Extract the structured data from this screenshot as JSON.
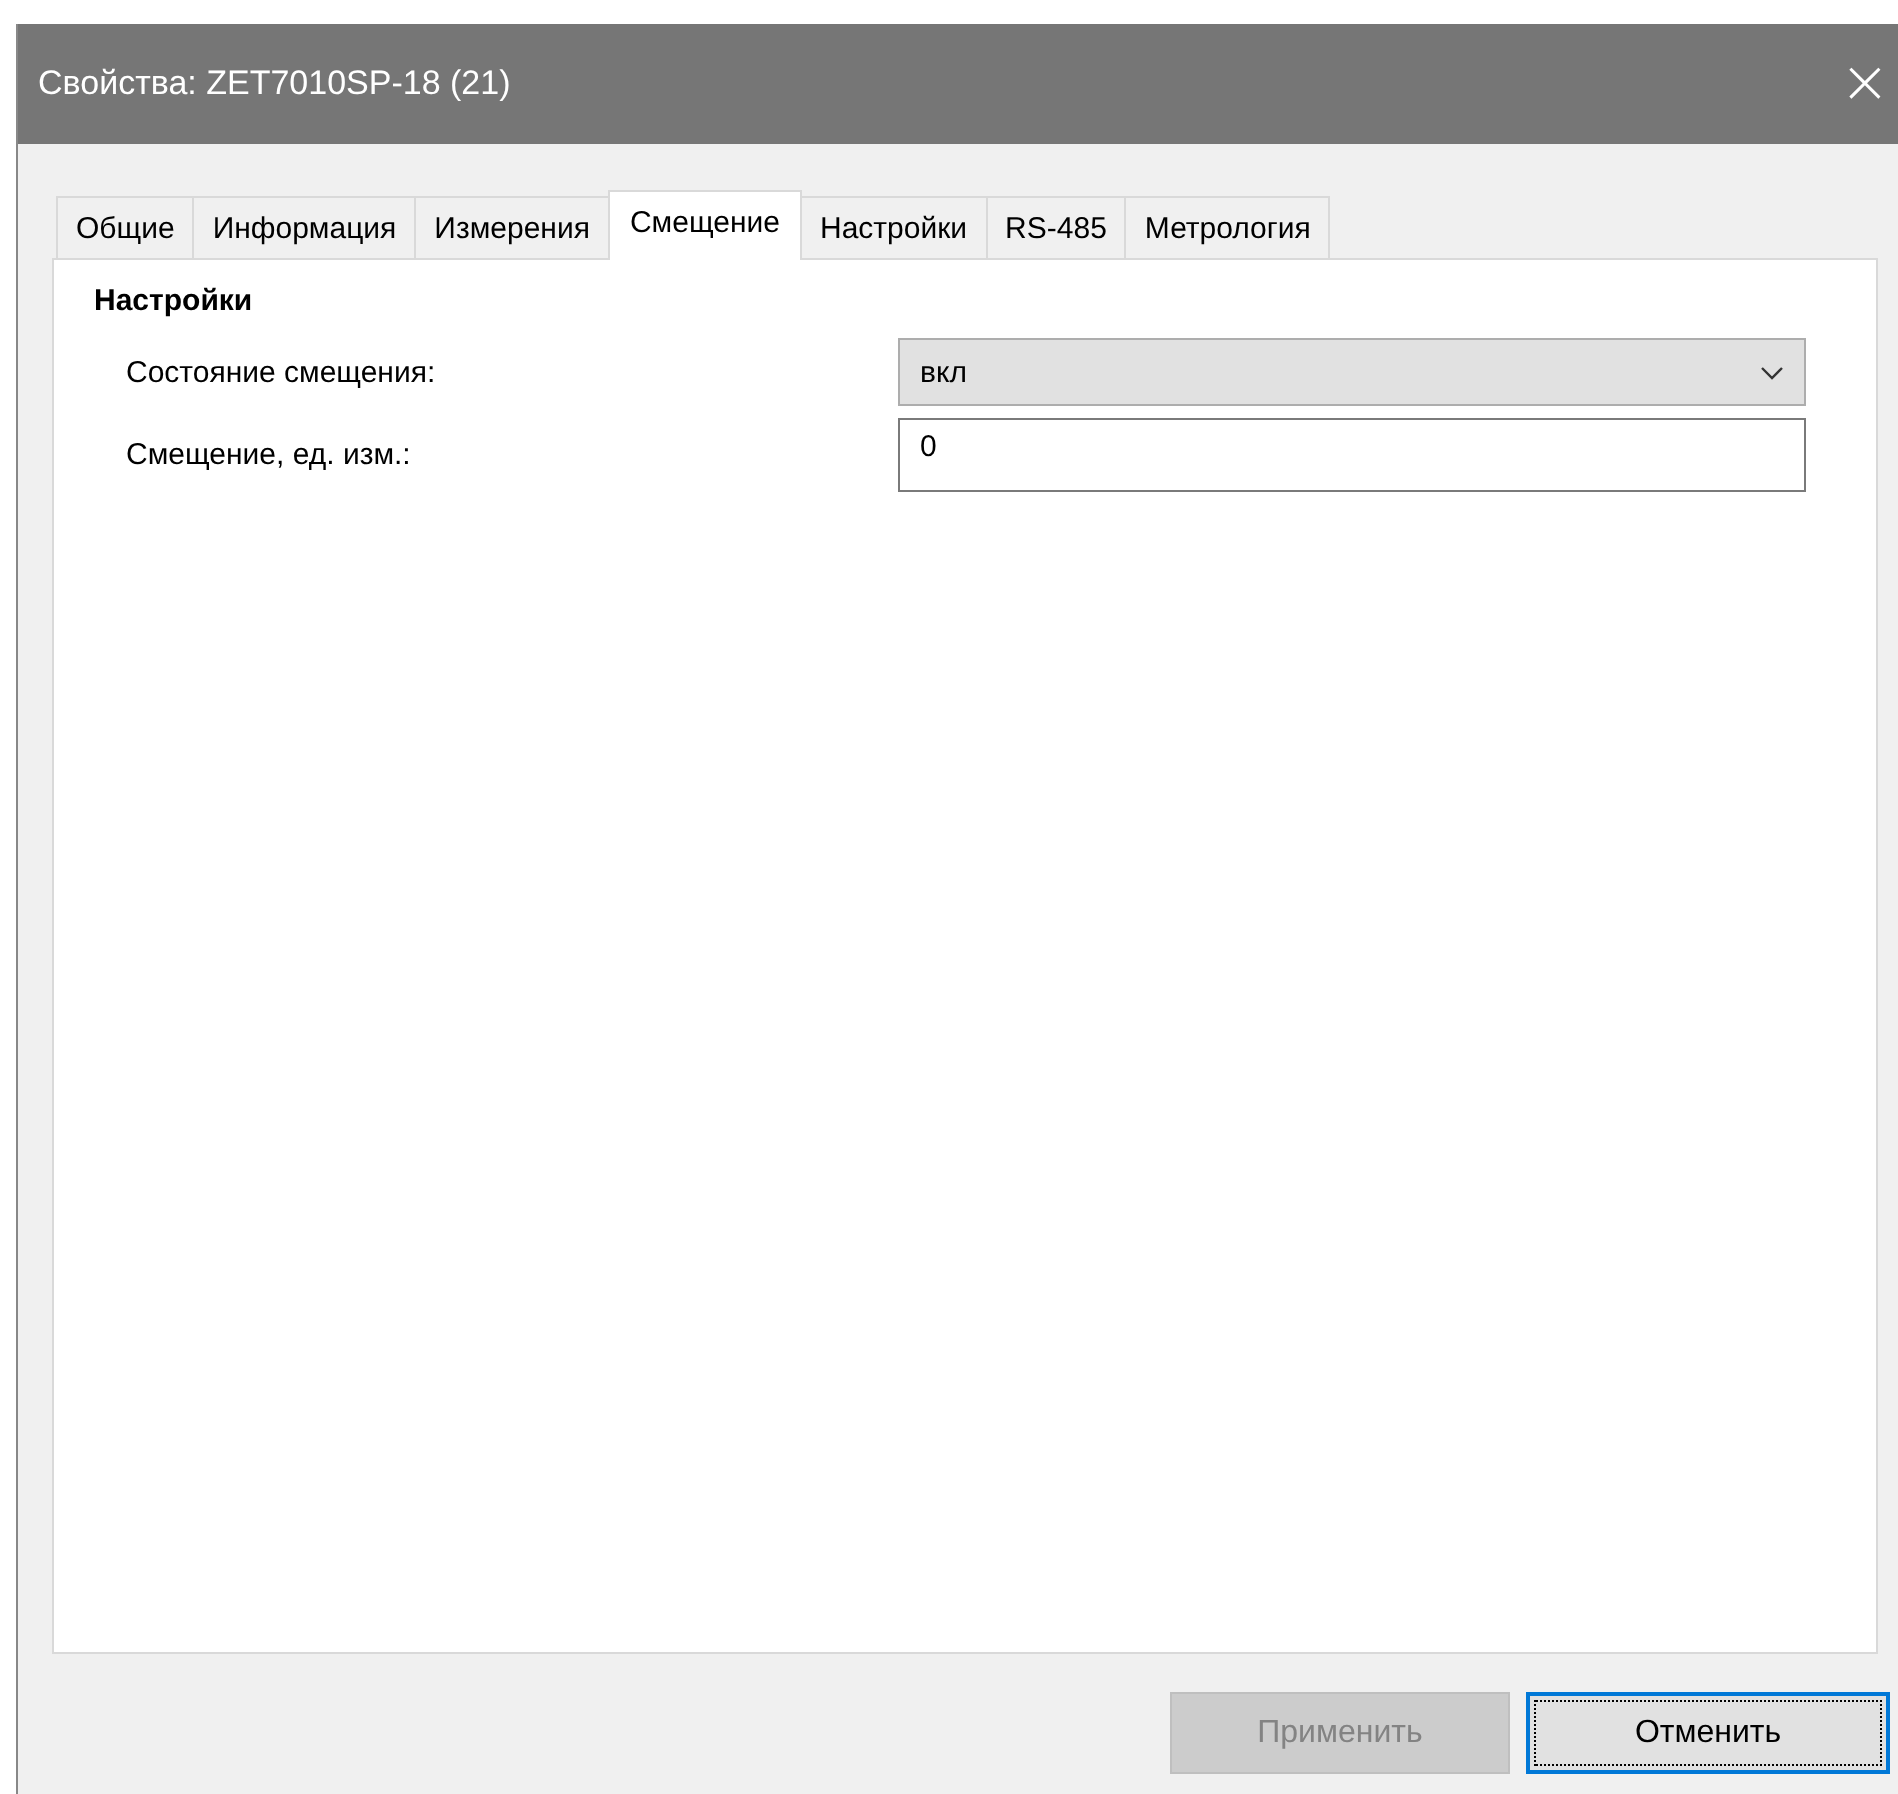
{
  "window": {
    "title": "Свойства: ZET7010SP-18 (21)",
    "close": "×"
  },
  "tabs": [
    {
      "label": "Общие",
      "selected": false
    },
    {
      "label": "Информация",
      "selected": false
    },
    {
      "label": "Измерения",
      "selected": false
    },
    {
      "label": "Смещение",
      "selected": true
    },
    {
      "label": "Настройки",
      "selected": false
    },
    {
      "label": "RS-485",
      "selected": false
    },
    {
      "label": "Метрология",
      "selected": false
    }
  ],
  "section": {
    "title": "Настройки",
    "fields": [
      {
        "kind": "dropdown",
        "label": "Состояние смещения:",
        "value": "вкл"
      },
      {
        "kind": "text",
        "label": "Смещение, ед. изм.:",
        "value": "0"
      }
    ]
  },
  "buttons": [
    {
      "label": "Применить",
      "disabled": true,
      "focused": false
    },
    {
      "label": "Отменить",
      "disabled": false,
      "focused": true
    }
  ]
}
